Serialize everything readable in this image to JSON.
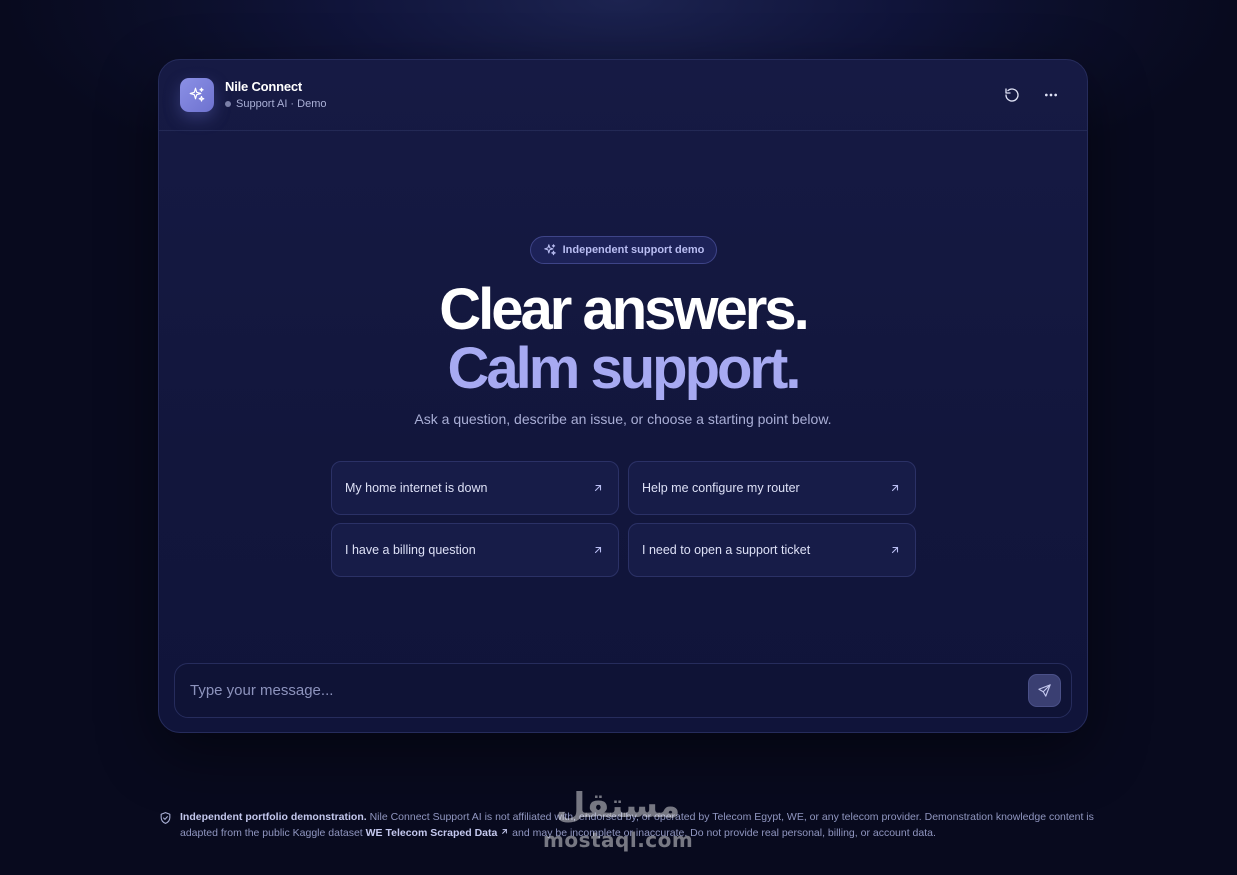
{
  "header": {
    "title": "Nile Connect",
    "subtitle": "Support AI · Demo",
    "restart_icon": "restart-icon",
    "more_icon": "more-dots-icon"
  },
  "badge": {
    "label": "Independent support demo",
    "icon": "sparkles-icon"
  },
  "hero": {
    "line1": "Clear answers.",
    "line2": "Calm support.",
    "subtitle": "Ask a question, describe an issue, or choose a starting point below."
  },
  "suggestions": [
    {
      "label": "My home internet is down"
    },
    {
      "label": "Help me configure my router"
    },
    {
      "label": "I have a billing question"
    },
    {
      "label": "I need to open a support ticket"
    }
  ],
  "composer": {
    "placeholder": "Type your message...",
    "send_icon": "send-icon"
  },
  "footer": {
    "lead": "Independent portfolio demonstration.",
    "text1": " Nile Connect Support AI is not affiliated with, endorsed by, or operated by Telecom Egypt, WE, or any telecom provider. Demonstration knowledge content is adapted from the public Kaggle dataset ",
    "link": "WE Telecom Scraped Data",
    "text2": " and may be incomplete or inaccurate. Do not provide real personal, billing, or account data."
  },
  "watermark": {
    "arabic": "مستقل",
    "latin": "mostaql.com"
  },
  "colors": {
    "accent": "#a7aaf2",
    "background": "#0b0e28",
    "panel": "#12163c"
  }
}
